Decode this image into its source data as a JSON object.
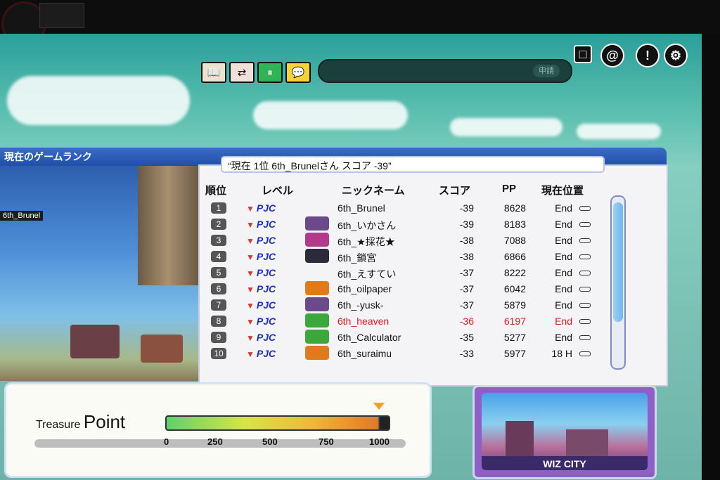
{
  "toolbar": {
    "buttons": [
      {
        "name": "book",
        "glyph": "📖",
        "bg": "#e8e4d0"
      },
      {
        "name": "transfer",
        "glyph": "⇄",
        "bg": "#f0e0d8"
      },
      {
        "name": "pause",
        "glyph": "⏸",
        "bg": "#2fb356"
      },
      {
        "name": "chat",
        "glyph": "💬",
        "bg": "#f4d23a"
      }
    ],
    "request_label": "申請",
    "top_icons": [
      "□",
      "@",
      "!",
      "⚙"
    ]
  },
  "scene": {
    "player_label": "6th_Brunel"
  },
  "ranking": {
    "window_title": "現在のゲームランク",
    "banner": "“現在 1位 6th_Brunelさん スコア -39”",
    "headers": {
      "rank": "順位",
      "level": "レベル",
      "nickname": "ニックネーム",
      "score": "スコア",
      "pp": "PP",
      "position": "現在位置"
    },
    "rows": [
      {
        "rank": "1",
        "level": "PJC",
        "nickname": "6th_Brunel",
        "score": "-39",
        "pp": "8628",
        "pos": "End",
        "avatar": ""
      },
      {
        "rank": "2",
        "level": "PJC",
        "nickname": "6th_いかさん",
        "score": "-39",
        "pp": "8183",
        "pos": "End",
        "avatar": "#6a4a8a"
      },
      {
        "rank": "3",
        "level": "PJC",
        "nickname": "6th_★採花★",
        "score": "-38",
        "pp": "7088",
        "pos": "End",
        "avatar": "#b23a8a"
      },
      {
        "rank": "4",
        "level": "PJC",
        "nickname": "6th_鎖宮",
        "score": "-38",
        "pp": "6866",
        "pos": "End",
        "avatar": "#2a2a3a"
      },
      {
        "rank": "5",
        "level": "PJC",
        "nickname": "6th_えすてい",
        "score": "-37",
        "pp": "8222",
        "pos": "End",
        "avatar": ""
      },
      {
        "rank": "6",
        "level": "PJC",
        "nickname": "6th_oilpaper",
        "score": "-37",
        "pp": "6042",
        "pos": "End",
        "avatar": "#e07a1a"
      },
      {
        "rank": "7",
        "level": "PJC",
        "nickname": "6th_-yusk-",
        "score": "-37",
        "pp": "5879",
        "pos": "End",
        "avatar": "#6a4a8a"
      },
      {
        "rank": "8",
        "level": "PJC",
        "nickname": "6th_heaven",
        "score": "-36",
        "pp": "6197",
        "pos": "End",
        "avatar": "#3aa83a",
        "highlight": true
      },
      {
        "rank": "9",
        "level": "PJC",
        "nickname": "6th_Calculator",
        "score": "-35",
        "pp": "5277",
        "pos": "End",
        "avatar": "#3aa83a"
      },
      {
        "rank": "10",
        "level": "PJC",
        "nickname": "6th_suraimu",
        "score": "-33",
        "pp": "5977",
        "pos": "18 H",
        "avatar": "#e07a1a"
      }
    ]
  },
  "treasure": {
    "label_small": "Treasure",
    "label_big": "Point",
    "ticks": [
      "0",
      "250",
      "500",
      "750",
      "1000"
    ]
  },
  "minimap": {
    "location": "WIZ CITY"
  },
  "colors": {
    "accent": "#1f4fa8",
    "highlight_row": "#d41c1c",
    "level_text": "#1b2fc0"
  }
}
